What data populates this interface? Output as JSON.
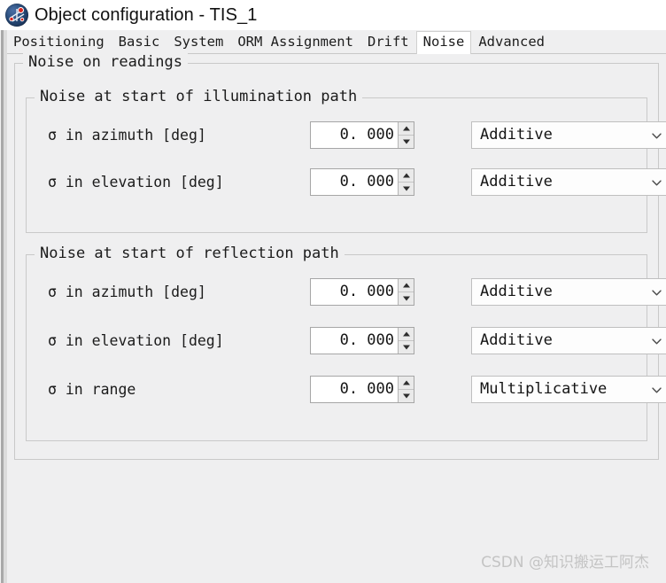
{
  "window": {
    "title": "Object configuration - TIS_1",
    "icon": "satellite-icon"
  },
  "tabs": [
    {
      "label": "Positioning",
      "selected": false
    },
    {
      "label": "Basic",
      "selected": false
    },
    {
      "label": "System",
      "selected": false
    },
    {
      "label": "ORM Assignment",
      "selected": false
    },
    {
      "label": "Drift",
      "selected": false
    },
    {
      "label": "Noise",
      "selected": true
    },
    {
      "label": "Advanced",
      "selected": false
    }
  ],
  "groups": {
    "outer_title": "Noise on readings",
    "illumination": {
      "title": "Noise at start of illumination path",
      "rows": [
        {
          "label": "σ in azimuth [deg]",
          "value": "0. 000",
          "mode": "Additive"
        },
        {
          "label": "σ in elevation [deg]",
          "value": "0. 000",
          "mode": "Additive"
        }
      ]
    },
    "reflection": {
      "title": "Noise at start of reflection path",
      "rows": [
        {
          "label": "σ in azimuth [deg]",
          "value": "0. 000",
          "mode": "Additive"
        },
        {
          "label": "σ in elevation [deg]",
          "value": "0. 000",
          "mode": "Additive"
        },
        {
          "label": "σ in range",
          "value": "0. 000",
          "mode": "Multiplicative"
        }
      ]
    }
  },
  "watermark": "CSDN @知识搬运工阿杰",
  "colors": {
    "background": "#efeff0",
    "titlebar": "#ffffff",
    "field": "#ffffff",
    "border": "#c9c9c9",
    "text": "#1b1b1b"
  }
}
